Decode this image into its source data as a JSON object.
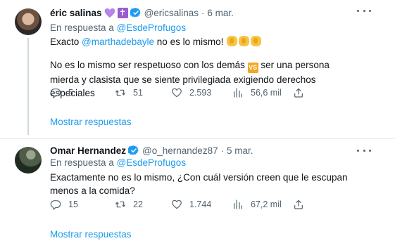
{
  "tweets": [
    {
      "name": "éric salinas",
      "handle": "@ericsalinas",
      "separator": "·",
      "date": "6 mar.",
      "reply_prefix": "En respuesta a ",
      "reply_to": "@EsdeProfugos",
      "text_start": "Exacto ",
      "mention": "@marthadebayle",
      "text_mid": " no es lo mismo! ",
      "text_p2_a": "No es lo mismo ser respetuoso con los demás ",
      "text_p2_b": " ser una persona mierda y clasista que se siente privilegiada exigiendo derechos especiales",
      "emoji_vs": "VS",
      "replies": "5",
      "retweets": "51",
      "likes": "2.593",
      "views": "56,6 mil",
      "show_replies": "Mostrar respuestas",
      "icons": [
        "purple-heart-icon",
        "latin-cross-icon",
        "verified-badge-icon",
        "clapping-hands-icon",
        "vs-button-icon"
      ]
    },
    {
      "name": "Omar Hernandez",
      "handle": "@o_hernandez87",
      "separator": "·",
      "date": "5 mar.",
      "reply_prefix": "En respuesta a ",
      "reply_to": "@EsdeProfugos",
      "text": "Exactamente no es lo mismo, ¿Con cuál versión creen que le escupan menos a la comida?",
      "replies": "15",
      "retweets": "22",
      "likes": "1.744",
      "views": "67,2 mil",
      "show_replies": "Mostrar respuestas",
      "icons": [
        "verified-badge-icon"
      ]
    }
  ],
  "colors": {
    "link": "#1d9bf0",
    "secondary_text": "#536471",
    "primary_text": "#0f1419",
    "verified": "#1d9bf0",
    "heart": "#b784e8"
  }
}
